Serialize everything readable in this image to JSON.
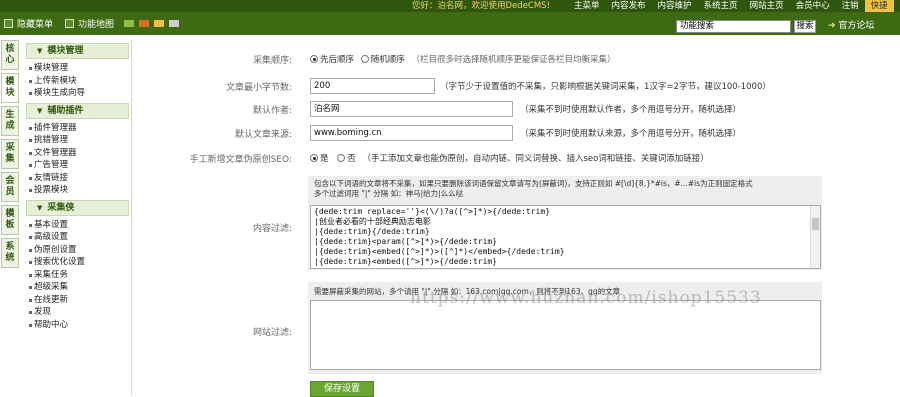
{
  "topbar": {
    "hide_menu": "隐藏菜单",
    "site_map": "功能地图",
    "welcome": "您好：泊名网，欢迎使用DedeCMS!",
    "nav": [
      "主菜单",
      "内容发布",
      "内容维护",
      "系统主页",
      "网站主页",
      "会员中心",
      "注销",
      "快捷"
    ],
    "search_value": "功能搜索",
    "search_button": "搜索",
    "forum": "官方论坛",
    "swatch_colors": [
      "#8fbf3e",
      "#d96b2b",
      "#f0c040",
      "#cccccc"
    ]
  },
  "vtabs": [
    "核心",
    "模块",
    "生成",
    "采集",
    "会员",
    "模板",
    "系统"
  ],
  "sidebar": {
    "sections": [
      {
        "title": "模块管理",
        "items": [
          "模块管理",
          "上传新模块",
          "模块生成向导"
        ]
      },
      {
        "title": "辅助插件",
        "items": [
          "插件管理器",
          "挑错管理",
          "文件管理器",
          "广告管理",
          "友情链接",
          "投票模块"
        ]
      },
      {
        "title": "采集侠",
        "items": [
          "基本设置",
          "高级设置",
          "伪原创设置",
          "搜索优化设置",
          "采集任务",
          "超级采集",
          "在线更新",
          "发现",
          "帮助中心"
        ]
      }
    ]
  },
  "form": {
    "order_label": "采集顺序:",
    "order_opt1": "先后顺序",
    "order_opt2": "随机顺序",
    "order_hint": "（栏目很多时选择随机顺序更能保证各栏目均衡采集）",
    "minbytes_label": "文章最小字节数:",
    "minbytes_value": "200",
    "minbytes_hint": "（字节少于设置值的不采集，只影响根据关键词采集，1汉字=2字节，建议100-1000）",
    "author_label": "默认作者:",
    "author_value": "泊名网",
    "author_hint": "（采集不到时使用默认作者，多个用逗号分开，随机选择）",
    "source_label": "默认文章来源:",
    "source_value": "www.boming.cn",
    "source_hint": "（采集不到时使用默认来源，多个用逗号分开，随机选择）",
    "seo_label": "手工新增文章伪原创SEO:",
    "seo_yes": "是",
    "seo_no": "否",
    "seo_hint": "（手工添加文章也能伪原创，自动内链、同义词替换、插入seo词和链接、关键词添加链接）",
    "filter_note1": "包含以下词语的文章将不采集，如果只要删除该词语保留文章请写为(屏蔽词)，支持正则如 #[\\d]{8,}*#is，#...#is为正则固定格式",
    "filter_note2": "多个过滤词用 \"|\" 分隔 如：神马|给力|么么哒",
    "filter_label": "内容过滤:",
    "filter_lines": [
      "{dede:trim replace=''}<(\\/)?a([^>]*)>{/dede:trim}",
      "|创业者必看的十部经典励志电影",
      "|{dede:trim}{/dede:trim}",
      "|{dede:trim}<param([^>]*)>{/dede:trim}",
      "|{dede:trim}<embed([^>]*)>([^]*)</embed>{/dede:trim}",
      "|{dede:trim}<embed([^>]*)>{/dede:trim}"
    ],
    "site_note": "需要屏蔽采集的网站，多个请用 \"|\" 分隔 如：163.com|qq.com，则将不到163、qq的文章",
    "site_label": "网站过滤:",
    "save_button": "保存设置"
  },
  "watermark": "https://www.huzhan.com/ishop15533"
}
